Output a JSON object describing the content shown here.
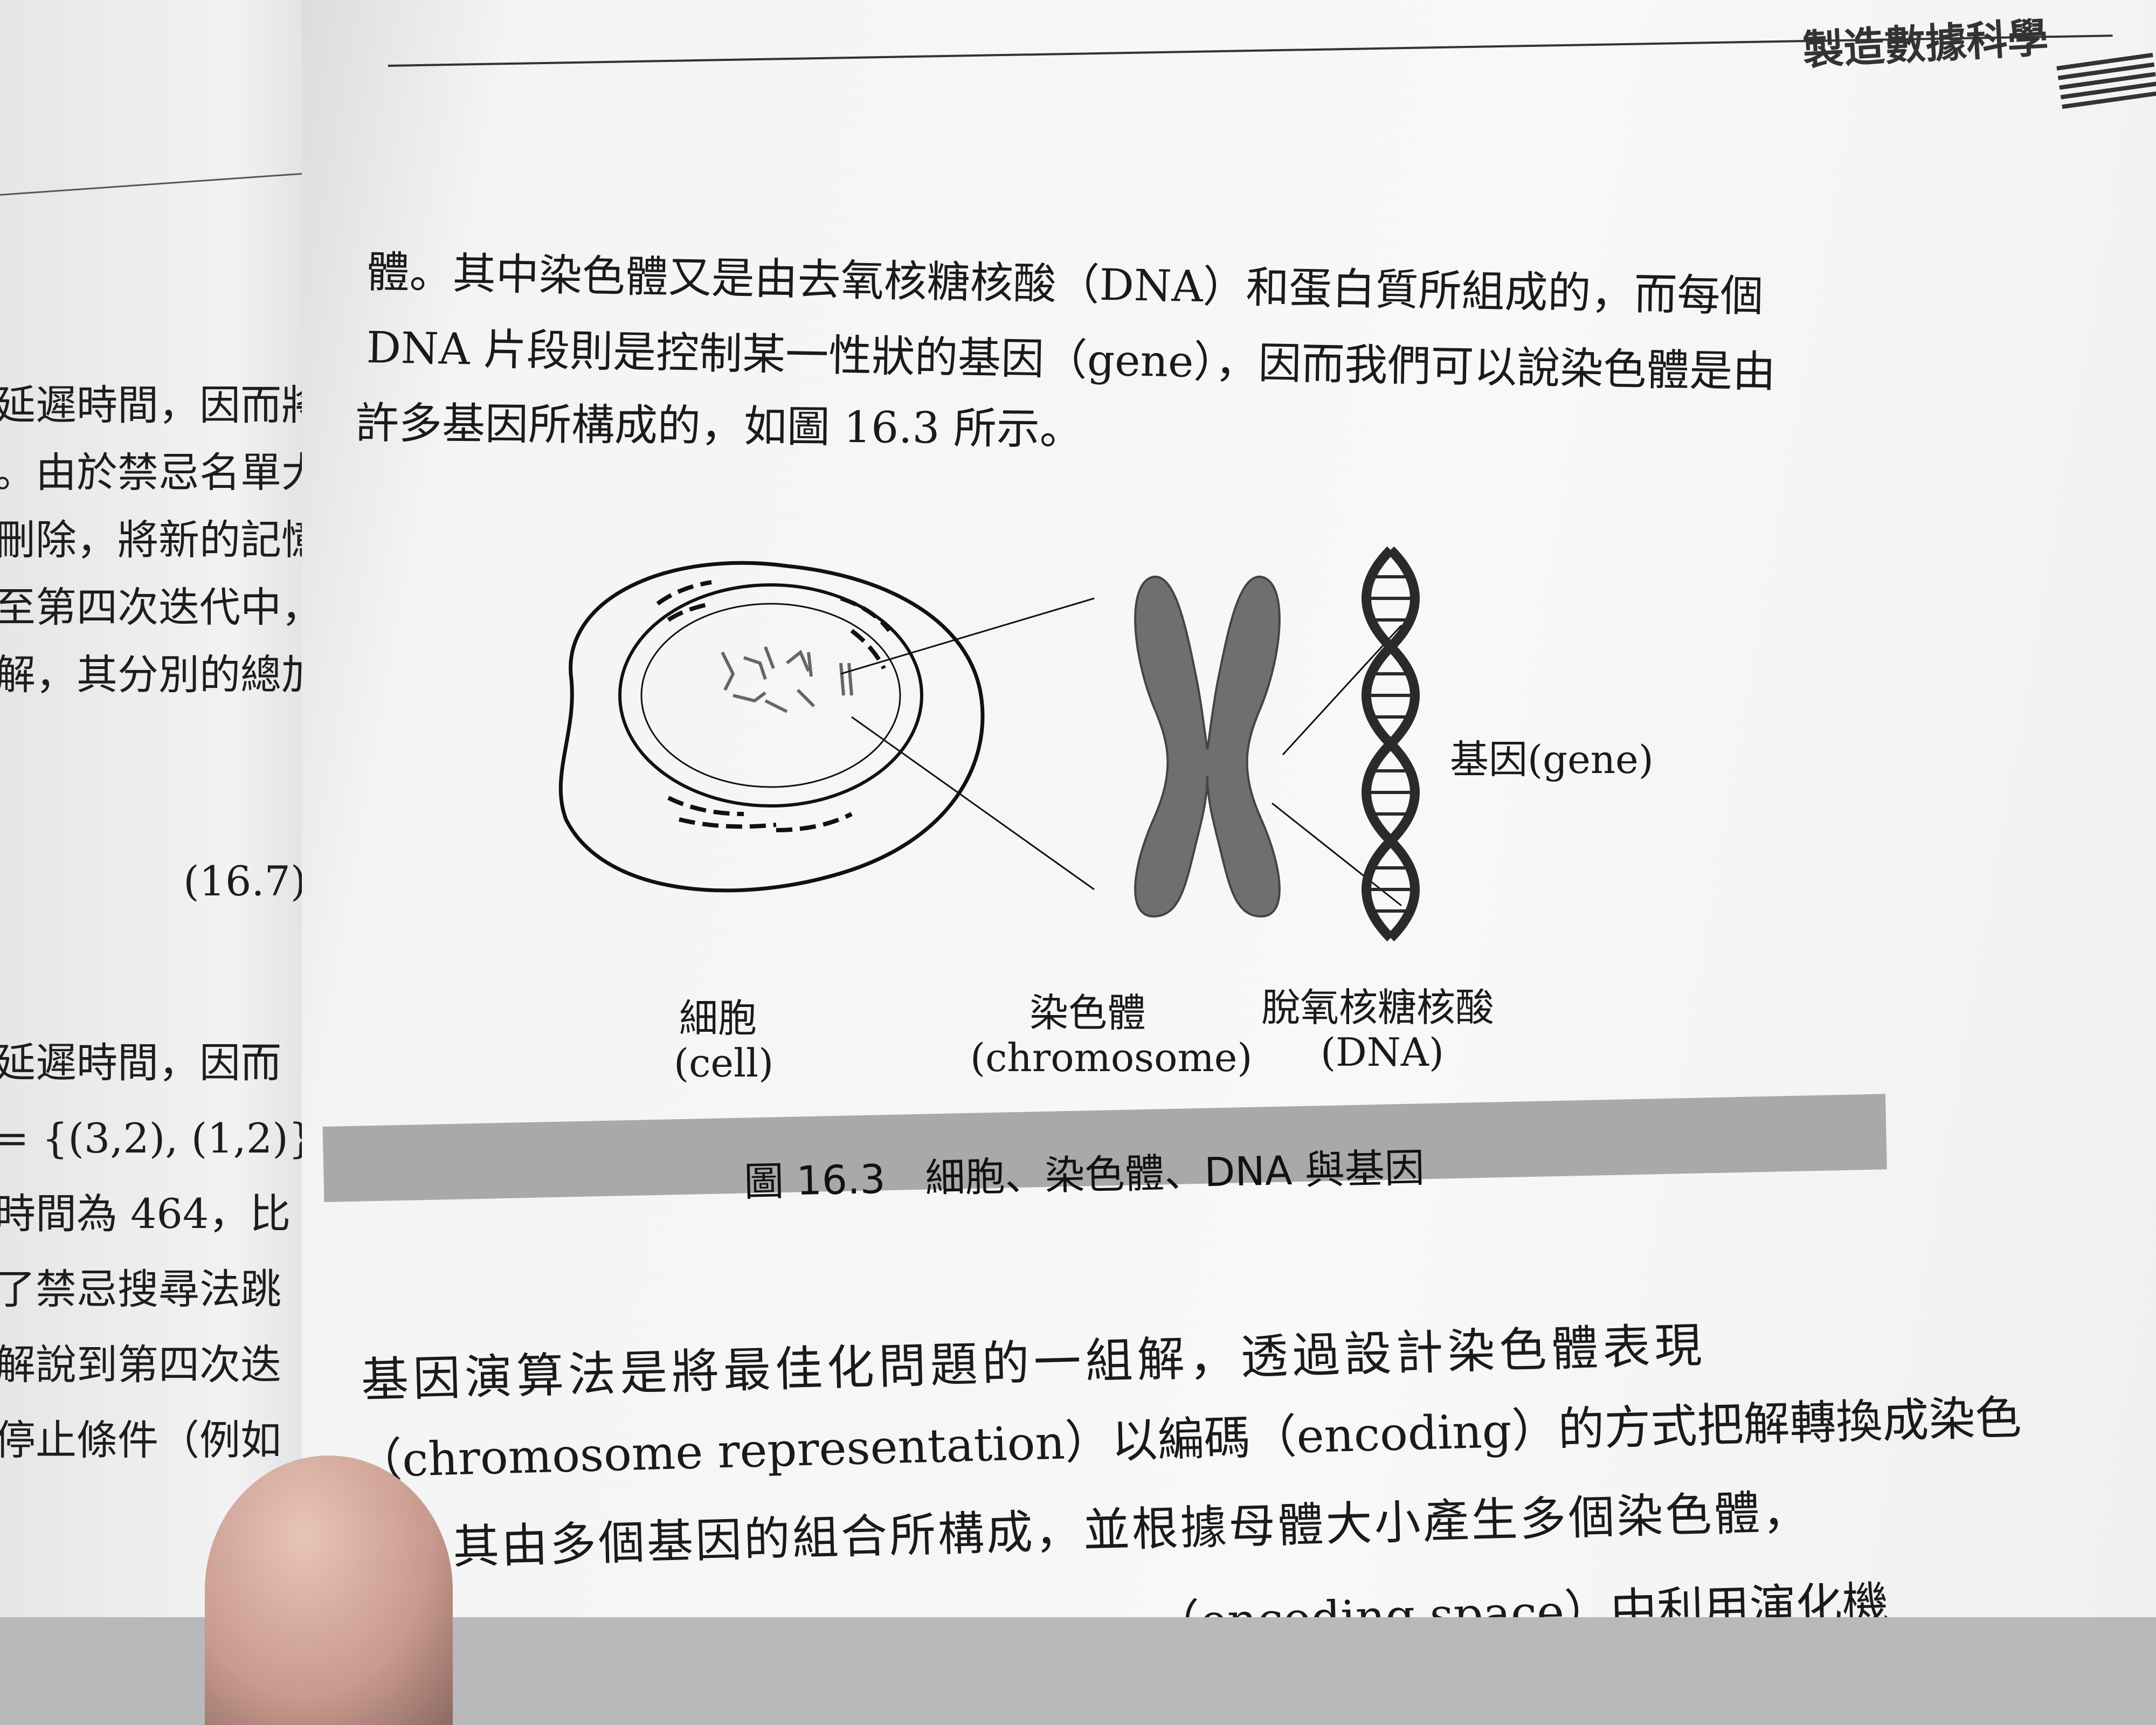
{
  "left_page": {
    "lines": [
      "延遲時間，因而將這",
      "。由於禁忌名單大小",
      "刪除，將新的記憶加",
      "至第四次迭代中，對",
      "解，其分別的總加"
    ],
    "equation_number": "(16.7)",
    "lines2": [
      "延遲時間，因而",
      "= {(3,2), (1,2)} 。",
      "時間為 464，比",
      "了禁忌搜尋法跳",
      "解說到第四次迭",
      "停止條件（例如"
    ]
  },
  "header": {
    "book_title": "製造數據科學"
  },
  "body_top": [
    "體。其中染色體又是由去氧核糖核酸（DNA）和蛋白質所組成的，而每個",
    "DNA 片段則是控制某一性狀的基因（gene），因而我們可以說染色體是由",
    "許多基因所構成的，如圖 16.3 所示。"
  ],
  "figure": {
    "cell_label": "細胞",
    "cell_label_en": "(cell)",
    "chromosome_label": "染色體",
    "chromosome_label_en": "(chromosome)",
    "dna_label": "脫氧核糖核酸",
    "dna_label_en": "(DNA)",
    "gene_label": "基因(gene)",
    "caption": "圖 16.3　細胞、染色體、DNA 與基因"
  },
  "body_bottom": [
    "基因演算法是將最佳化問題的一組解，透過設計染色體表現",
    "（chromosome representation）以編碼（encoding）的方式把解轉換成染色",
    "其由多個基因的組合所構成，並根據母體大小產生多個染色體，",
    "（encoding space）中利用演化機"
  ]
}
